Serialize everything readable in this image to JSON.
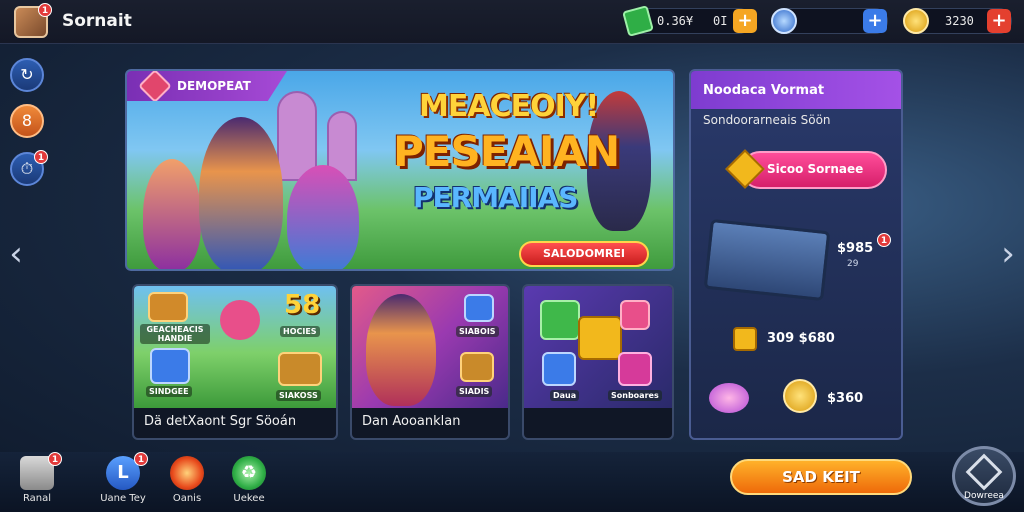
{
  "header": {
    "title": "Sornait",
    "app_icon": "treasure-chest-icon",
    "notification_count": "1",
    "resources": [
      {
        "icon": "cash-icon",
        "value": "0.36¥",
        "secondary": "0I",
        "plus_color": "#f5a623"
      },
      {
        "icon": "crystal-icon",
        "value": "",
        "secondary": "",
        "plus_color": "#3b7be8"
      },
      {
        "icon": "coin-icon",
        "value": "3230",
        "secondary": "",
        "plus_color": "#e4402f"
      }
    ]
  },
  "sidebar": {
    "items": [
      {
        "icon": "refresh-icon",
        "glyph": "↻"
      },
      {
        "icon": "eight-icon",
        "glyph": "8"
      },
      {
        "icon": "timer-icon",
        "glyph": "⏱",
        "badge": "1"
      }
    ]
  },
  "nav_arrows": {
    "left": "‹",
    "right": "›"
  },
  "hero": {
    "tag": "DEMOPEAT",
    "line1": "MEACEOIY!",
    "line2": "PESEAIAN",
    "line3": "PERMAIIAS",
    "button": "SALODOMREI"
  },
  "cards": [
    {
      "caption": "Dä detXaont Sgr Söoán",
      "labels": [
        "GEACHEACIS HANDIE",
        "SINDGEE",
        "HOCIES",
        "SIAKOSS"
      ],
      "big_number": "58"
    },
    {
      "caption": "Dan Aooanklan",
      "labels": [
        "SIABOIS",
        "SIADIS"
      ]
    },
    {
      "caption": "",
      "labels": [
        "Daua",
        "Sonboares"
      ]
    }
  ],
  "right_panel": {
    "header": "Noodaca Vormat",
    "subtitle": "Sondoorarneais Söön",
    "pill_label": "Sicoo Sornaee",
    "chest_price": "$985",
    "chest_badge": "1",
    "chest_sub": "29",
    "row1_value": "309 $680",
    "row2_value": "$360"
  },
  "bottom_nav": [
    {
      "label": "Ranal",
      "icon": "house-icon",
      "badge": "1"
    },
    {
      "label": "Uane Tey",
      "icon": "l-letter-icon",
      "badge": "1"
    },
    {
      "label": "Oanis",
      "icon": "flame-icon"
    },
    {
      "label": "Uekee",
      "icon": "recycle-icon"
    }
  ],
  "cta_button": "SAD KEIT",
  "home_button": "Dowreea",
  "colors": {
    "accent_purple": "#a451e6",
    "cta_orange": "#ee6a0a",
    "pill_pink": "#d61f6a",
    "hero_button_red": "#c81e1e"
  }
}
